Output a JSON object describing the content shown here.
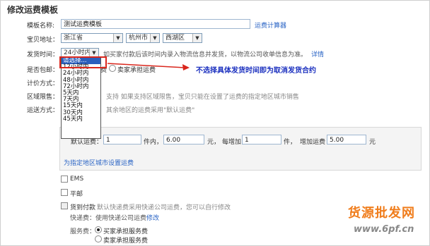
{
  "page": {
    "title": "修改运费模板",
    "template_name": {
      "label": "模板名称:",
      "value": "测试运费模板",
      "calc_link": "运费计算器"
    },
    "location": {
      "label": "宝贝地址：",
      "province": "浙江省",
      "city": "杭州市",
      "district": "西湖区"
    },
    "ship_time": {
      "label": "发货时间：",
      "selected": "24小时内",
      "hint": "如买家付款后该时间内录入物流信息并发货，以物流公司收单信息为准。",
      "hint_link": "详情",
      "options": [
        "请选择...",
        "12小时内",
        "24小时内",
        "48小时内",
        "72小时内",
        "5天内",
        "7天内",
        "15天内",
        "30天内",
        "45天内"
      ]
    },
    "annotation": "不选择具体发货时间即为取消发货合约",
    "free_ship": {
      "label": "是否包邮：",
      "opt1": "费",
      "opt2": "卖家承担运费"
    },
    "pricing": {
      "label": "计价方式："
    },
    "region": {
      "label": "区域限售：",
      "text": "支持  如果支持区域限售，宝贝只能在设置了运费的指定地区城市销售"
    },
    "ship_method": {
      "label": "运送方式：",
      "text": "其余地区的运费采用\"默认运费\""
    },
    "default_fee": {
      "prefix": "默认运费：",
      "first_qty": "1",
      "unit1": "件内，",
      "first_fee": "6.00",
      "yuan1": "元，",
      "each_add": "每增加",
      "add_qty": "1",
      "unit2": "件，",
      "add_fee_label": "增加运费",
      "add_fee": "5.00",
      "yuan2": "元",
      "region_link": "为指定地区城市设置运费"
    },
    "ems": "EMS",
    "post": "平邮",
    "cod": {
      "label": "货到付款",
      "text": "默认快递费采用快递公司运费，您可以自行修改",
      "fee_line": "快递费：使用快递公司运费",
      "fee_link": "修改",
      "service_label": "服务费：",
      "service_opt1": "买家承担服务费",
      "service_opt2": "卖家承担服务费"
    },
    "watermark": {
      "line1": "货源批发网",
      "line2": "www.6pf.cn"
    }
  }
}
